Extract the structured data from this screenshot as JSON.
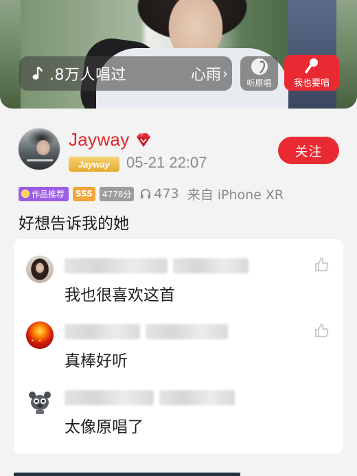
{
  "player": {
    "sing_count": ".8万人唱过",
    "song_name": "心雨",
    "song_chevron": "›",
    "original_label": "听原唱",
    "sing_label": "我也要唱",
    "icons": {
      "note": "music-note-icon",
      "original": "original-vocal-disc-icon",
      "sing": "microphone-icon"
    }
  },
  "author": {
    "name": "Jayway",
    "badge_name": "Jayway",
    "datetime": "05-21 22:07",
    "follow_label": "关注",
    "name_color": "#e0272e",
    "vip_icon": "red-diamond-vip-icon"
  },
  "meta": {
    "recommended_label": "作品推荐",
    "grade_label": "SSS",
    "score_label": "4778分",
    "plays": "473",
    "source": "来自 iPhone XR",
    "plays_icon": "headphones-icon"
  },
  "caption": "好想告诉我的她",
  "comments": [
    {
      "text": "我也很喜欢这首",
      "avatar_icon": "user-avatar-girl"
    },
    {
      "text": "真棒好听",
      "avatar_icon": "user-avatar-candle"
    },
    {
      "text": "太像原唱了",
      "avatar_icon": "user-avatar-cartoon"
    }
  ],
  "colors": {
    "accent_red": "#ea2a33",
    "badge_purple": "#9b5ce6",
    "badge_orange": "#f1a637",
    "badge_gray": "#9d9d9d",
    "text_gray": "#8a8a8a"
  }
}
